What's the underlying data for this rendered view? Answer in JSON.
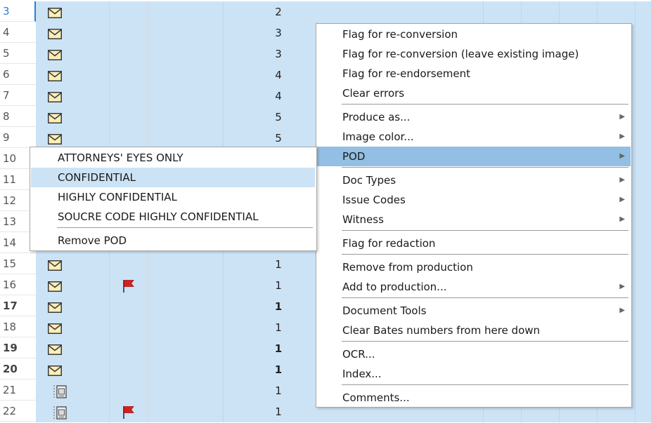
{
  "rows": [
    {
      "num": "3",
      "count": "2",
      "icon": "envelope",
      "flag": false,
      "bold": false,
      "current": true
    },
    {
      "num": "4",
      "count": "3",
      "icon": "envelope",
      "flag": false,
      "bold": false
    },
    {
      "num": "5",
      "count": "3",
      "icon": "envelope",
      "flag": false,
      "bold": false
    },
    {
      "num": "6",
      "count": "4",
      "icon": "envelope",
      "flag": false,
      "bold": false
    },
    {
      "num": "7",
      "count": "4",
      "icon": "envelope",
      "flag": false,
      "bold": false
    },
    {
      "num": "8",
      "count": "5",
      "icon": "envelope",
      "flag": false,
      "bold": false
    },
    {
      "num": "9",
      "count": "5",
      "icon": "envelope",
      "flag": false,
      "bold": false
    },
    {
      "num": "10",
      "count": "",
      "icon": "",
      "flag": false,
      "bold": false
    },
    {
      "num": "11",
      "count": "",
      "icon": "",
      "flag": false,
      "bold": false
    },
    {
      "num": "12",
      "count": "",
      "icon": "",
      "flag": false,
      "bold": false
    },
    {
      "num": "13",
      "count": "",
      "icon": "",
      "flag": false,
      "bold": false
    },
    {
      "num": "14",
      "count": "",
      "icon": "",
      "flag": false,
      "bold": false
    },
    {
      "num": "15",
      "count": "1",
      "icon": "envelope",
      "flag": false,
      "bold": false
    },
    {
      "num": "16",
      "count": "1",
      "icon": "envelope",
      "flag": true,
      "bold": false
    },
    {
      "num": "17",
      "count": "1",
      "icon": "envelope",
      "flag": false,
      "bold": true
    },
    {
      "num": "18",
      "count": "1",
      "icon": "envelope",
      "flag": false,
      "bold": false
    },
    {
      "num": "19",
      "count": "1",
      "icon": "envelope",
      "flag": false,
      "bold": true
    },
    {
      "num": "20",
      "count": "1",
      "icon": "envelope",
      "flag": false,
      "bold": true
    },
    {
      "num": "21",
      "count": "1",
      "icon": "document",
      "flag": false,
      "bold": false
    },
    {
      "num": "22",
      "count": "1",
      "icon": "document",
      "flag": true,
      "bold": false
    }
  ],
  "context_menu": {
    "items": [
      {
        "label": "Flag for re-conversion",
        "submenu": false
      },
      {
        "label": "Flag for re-conversion (leave existing image)",
        "submenu": false
      },
      {
        "label": "Flag for re-endorsement",
        "submenu": false
      },
      {
        "label": "Clear errors",
        "submenu": false
      },
      {
        "label": "Produce as...",
        "submenu": true
      },
      {
        "label": "Image color...",
        "submenu": true
      },
      {
        "label": "POD",
        "submenu": true,
        "highlighted": true
      },
      {
        "label": "Doc Types",
        "submenu": true
      },
      {
        "label": "Issue Codes",
        "submenu": true
      },
      {
        "label": "Witness",
        "submenu": true
      },
      {
        "label": "Flag for redaction",
        "submenu": false
      },
      {
        "label": "Remove from production",
        "submenu": false
      },
      {
        "label": "Add to production...",
        "submenu": true
      },
      {
        "label": "Document Tools",
        "submenu": true
      },
      {
        "label": "Clear Bates numbers from here down",
        "submenu": false
      },
      {
        "label": "OCR...",
        "submenu": false
      },
      {
        "label": "Index...",
        "submenu": false
      },
      {
        "label": "Comments...",
        "submenu": false
      }
    ]
  },
  "pod_submenu": {
    "items": [
      {
        "label": "ATTORNEYS' EYES ONLY"
      },
      {
        "label": "CONFIDENTIAL",
        "highlighted": true
      },
      {
        "label": "HIGHLY CONFIDENTIAL"
      },
      {
        "label": "SOUCRE CODE HIGHLY CONFIDENTIAL"
      },
      {
        "label": "Remove POD"
      }
    ]
  },
  "colors": {
    "row_background": "#cce3f6",
    "menu_highlight": "#92bfe3",
    "flag": "#d62020",
    "envelope": "#fbeeb8"
  }
}
